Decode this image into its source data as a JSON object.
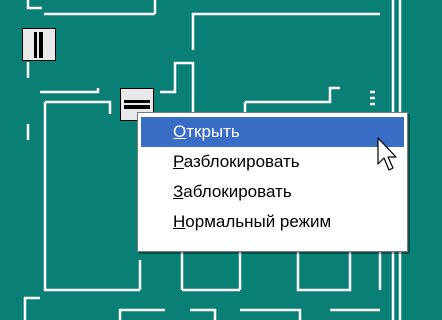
{
  "context_menu": {
    "items": [
      {
        "label": "Открыть",
        "highlighted": true
      },
      {
        "label": "Разблокировать",
        "highlighted": false
      },
      {
        "label": "Заблокировать",
        "highlighted": false
      },
      {
        "label": "Нормальный режим",
        "highlighted": false
      }
    ],
    "highlight_color": "#3a6ec6"
  },
  "canvas": {
    "background_color": "#097f76",
    "wall_color": "#ffffff"
  },
  "icons": [
    "door-closed-vertical-icon",
    "door-closed-horizontal-icon",
    "mouse-pointer-icon"
  ]
}
